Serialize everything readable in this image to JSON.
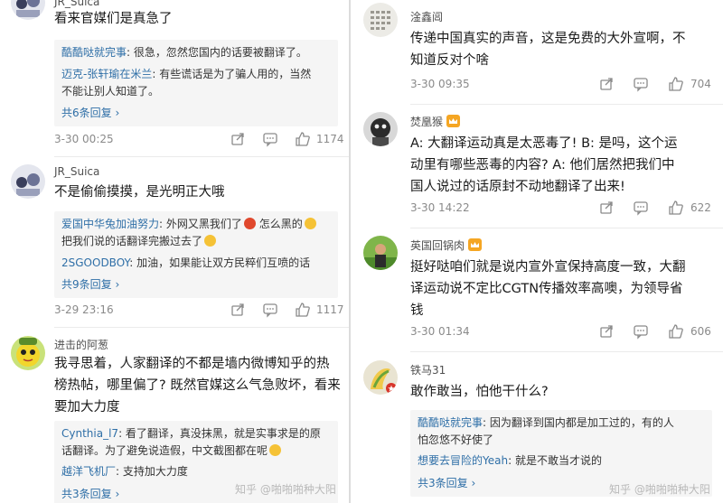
{
  "left": {
    "c1": {
      "user": "JR_Suica",
      "text": "看来官媒们是真急了",
      "replies": [
        {
          "user": "酷酷哒就完事",
          "text": ": 很急，忽然您国内的话要被翻译了。"
        },
        {
          "user": "迈克-张轩瑜在米兰",
          "text": ": 有些谎话是为了骗人用的，当然",
          "text2": "不能让别人知道了。"
        }
      ],
      "more": "共6条回复",
      "time": "3-30 00:25",
      "likes": "1174"
    },
    "c2": {
      "user": "JR_Suica",
      "text": "不是偷偷摸摸，是光明正大哦",
      "replies": [
        {
          "user": "爱国中华兔加油努力",
          "text": ": 外网又黑我们了",
          "text_b": " 怎么黑的",
          "text2": "把我们说的话翻译完搬过去了"
        },
        {
          "user": "2SGOODBOY",
          "text": ": 加油，如果能让双方民粹们互喷的话"
        }
      ],
      "more": "共9条回复",
      "time": "3-29 23:16",
      "likes": "1117"
    },
    "c3": {
      "user": "进击的阿葱",
      "text_lines": [
        "我寻思着，人家翻译的不都是墙内微博知乎的热",
        "榜热帖，哪里偏了? 既然官媒这么气急败坏，看来",
        "要加大力度"
      ],
      "replies": [
        {
          "user": "Cynthia_l7",
          "text": ": 看了翻译，真没抹黑，就是实事求是的原",
          "text2": "话翻译。为了避免说造假，中文截图都在呢"
        },
        {
          "user": "越洋飞机厂",
          "text": ": 支持加大力度"
        }
      ],
      "more": "共3条回复"
    },
    "watermark": "知乎 @啪啪啪种大阳"
  },
  "right": {
    "c1": {
      "user": "淦鑫阊",
      "text_lines": [
        "传递中国真实的声音，这是免费的大外宣啊，不",
        "知道反对个啥"
      ],
      "time": "3-30 09:35",
      "likes": "704"
    },
    "c2": {
      "user": "焚凰猴",
      "text_lines": [
        "A: 大翻译运动真是太恶毒了! B: 是吗，这个运",
        "动里有哪些恶毒的内容? A: 他们居然把我们中",
        "国人说过的话原封不动地翻译了出来!"
      ],
      "time": "3-30 14:22",
      "likes": "622"
    },
    "c3": {
      "user": "英国回锅肉",
      "text_lines": [
        "挺好哒咱们就是说内宣外宣保持高度一致，大翻",
        "译运动说不定比CGTN传播效率高噢，为领导省",
        "钱"
      ],
      "time": "3-30 01:34",
      "likes": "606"
    },
    "c4": {
      "user": "铁马31",
      "text": "敢作敢当，怕他干什么?",
      "replies": [
        {
          "user": "酷酷哒就完事",
          "text": ": 因为翻译到国内都是加工过的，有的人",
          "text2": "怕忽悠不好使了"
        },
        {
          "user": "想要去冒险的Yeah",
          "text": ": 就是不敢当才说的"
        }
      ],
      "more": "共3条回复"
    },
    "watermark": "知乎 @啪啪啪种大阳"
  },
  "icons": {
    "share": "share-icon",
    "reply": "comment-icon",
    "like": "thumbs-up-icon",
    "chevron": "chevron-right-icon"
  },
  "colors": {
    "link": "#2f6fa7",
    "badge": "#f5a623"
  }
}
